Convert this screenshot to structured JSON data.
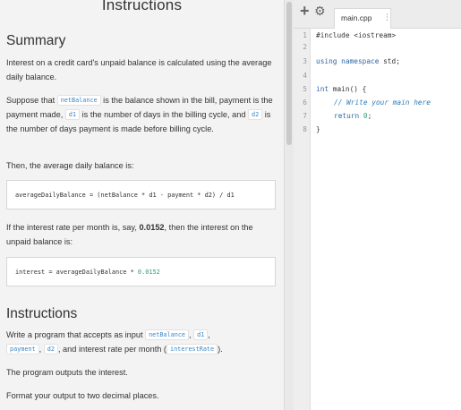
{
  "instructions_panel": {
    "top_title": "Instructions",
    "summary": {
      "heading": "Summary",
      "intro": "Interest on a credit card's unpaid balance is calculated using the average daily balance.",
      "vars_p1": "Suppose that ",
      "var_netBalance": "netBalance",
      "vars_p2": " is the balance shown in the bill, payment is the payment made, ",
      "var_d1": "d1",
      "vars_p3": " is the number of days in the billing cycle, and ",
      "var_d2": "d2",
      "vars_p4": " is the number of days payment is made before billing cycle.",
      "then_text": "Then, the average daily balance is:",
      "formula": "averageDailyBalance = (netBalance * d1 - payment * d2) / d1",
      "rate_p1": "If the interest rate per month is, say, ",
      "rate_value": "0.0152",
      "rate_p2": ", then the interest on the unpaid balance is:",
      "interest_lhs": "interest = averageDailyBalance * ",
      "interest_num": "0.0152"
    },
    "instructions": {
      "heading": "Instructions",
      "write_p1": "Write a program that accepts as input ",
      "input_netBalance": "netBalance",
      "sep1": ", ",
      "input_d1": "d1",
      "sep2": ",",
      "input_payment": "payment",
      "sep3": ", ",
      "input_d2": "d2",
      "write_p2": ", and interest rate per month (",
      "input_interestRate": "interestRate",
      "write_p3": ").",
      "outputs_text": "The program outputs the interest.",
      "format_text": "Format your output to two decimal places."
    }
  },
  "editor": {
    "add_icon": "plus-icon",
    "settings_icon": "gear-icon",
    "tab_label": "main.cpp",
    "tab_menu_icon": "vertical-dots-icon",
    "line_numbers": [
      "1",
      "2",
      "3",
      "4",
      "5",
      "6",
      "7",
      "8"
    ],
    "code": {
      "l1": "#include <iostream>",
      "l3_kw": "using namespace",
      "l3_rest": " std;",
      "l5_kw": "int",
      "l5_rest": " main() {",
      "l6_comment": "// Write your main here",
      "l7_kw": "return",
      "l7_num": "0",
      "l7_semi": ";",
      "l8": "}"
    }
  },
  "colors": {
    "panel_bg": "#f3f3f3",
    "inline_code": "#3b87c7",
    "keyword": "#2966a8",
    "number": "#2d9e7a"
  }
}
